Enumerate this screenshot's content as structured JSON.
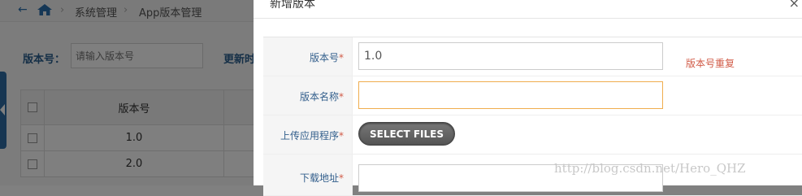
{
  "breadcrumb": {
    "items": [
      "系统管理",
      "App版本管理"
    ]
  },
  "search": {
    "label": "版本号：",
    "placeholder": "请输入版本号",
    "label2": "更新时"
  },
  "table": {
    "header": "版本号",
    "rows": [
      "1.0",
      "2.0"
    ]
  },
  "modal": {
    "title": "新增版本",
    "close": "×",
    "fields": [
      {
        "label": "版本号",
        "required": "*",
        "value": "1.0",
        "error": "版本号重复"
      },
      {
        "label": "版本名称",
        "required": "*",
        "value": ""
      },
      {
        "label": "上传应用程序",
        "required": "*",
        "button": "SELECT FILES"
      },
      {
        "label": "下载地址",
        "required": "*",
        "value": ""
      }
    ]
  },
  "watermark": "http://blog.csdn.net/Hero_QHZ",
  "colors": {
    "accent": "#2e6da4",
    "error": "#d15b47",
    "focus": "#f0ad4e"
  }
}
